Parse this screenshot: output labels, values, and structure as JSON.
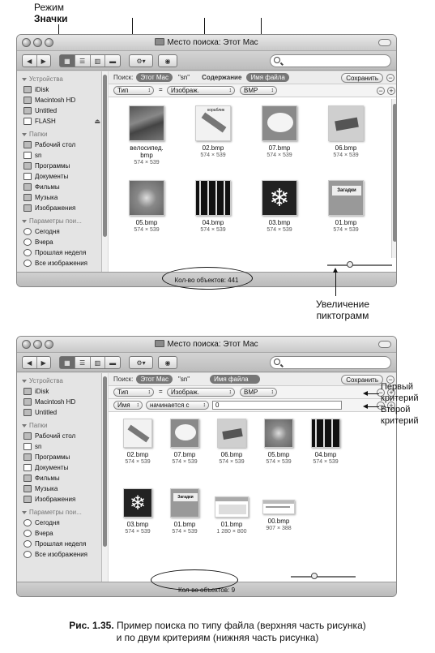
{
  "callouts": {
    "mode_line1": "Режим",
    "mode_line2": "Значки",
    "zoom_line1": "Увеличение",
    "zoom_line2": "пиктограмм",
    "crit1_line1": "Первый",
    "crit1_line2": "критерий",
    "crit2_line1": "Второй",
    "crit2_line2": "критерий"
  },
  "top_window": {
    "title": "Место поиска: Этот Mac",
    "search_label": "Поиск:",
    "scope_this_mac": "Этот Mac",
    "scope_user": "\"sn\"",
    "by_contents": "Содержание",
    "by_filename": "Имя файла",
    "save_label": "Сохранить",
    "criteria": {
      "kind": "Тип",
      "value": "Изображ.",
      "format": "BMP"
    },
    "status": "Кол-во объектов: 441",
    "files": [
      {
        "name": "велосипед.\nbmp",
        "dims": "574 × 539"
      },
      {
        "name": "02.bmp",
        "dims": "574 × 539"
      },
      {
        "name": "07.bmp",
        "dims": "574 × 539"
      },
      {
        "name": "06.bmp",
        "dims": "574 × 539"
      },
      {
        "name": "05.bmp",
        "dims": "574 × 539"
      },
      {
        "name": "04.bmp",
        "dims": "574 × 539"
      },
      {
        "name": "03.bmp",
        "dims": "574 × 539"
      },
      {
        "name": "01.bmp",
        "dims": "574 × 539"
      }
    ]
  },
  "bottom_window": {
    "title": "Место поиска: Этот Mac",
    "search_label": "Поиск:",
    "scope_this_mac": "Этот Mac",
    "scope_user": "\"sn\"",
    "by_filename": "Имя файла",
    "save_label": "Сохранить",
    "criteria1": {
      "kind": "Тип",
      "value": "Изображ.",
      "format": "BMP"
    },
    "criteria2": {
      "attr": "Имя",
      "op": "начинается с",
      "value": "0"
    },
    "status": "Кол-во объектов: 9",
    "files": [
      {
        "name": "02.bmp",
        "dims": "574 × 539"
      },
      {
        "name": "07.bmp",
        "dims": "574 × 539"
      },
      {
        "name": "06.bmp",
        "dims": "574 × 539"
      },
      {
        "name": "05.bmp",
        "dims": "574 × 539"
      },
      {
        "name": "04.bmp",
        "dims": "574 × 539"
      },
      {
        "name": "03.bmp",
        "dims": "574 × 539"
      },
      {
        "name": "01.bmp",
        "dims": "574 × 539"
      },
      {
        "name": "01.bmp",
        "dims": "1 280 × 800"
      },
      {
        "name": "00.bmp",
        "dims": "907 × 388"
      }
    ]
  },
  "sidebar": {
    "devices_head": "Устройства",
    "devices": [
      "iDisk",
      "Macintosh HD",
      "Untitled",
      "FLASH"
    ],
    "places_head": "Папки",
    "places": [
      "Рабочий стол",
      "sn",
      "Программы",
      "Документы",
      "Фильмы",
      "Музыка",
      "Изображения"
    ],
    "search_head": "Параметры пои...",
    "searches": [
      "Сегодня",
      "Вчера",
      "Прошлая неделя",
      "Все изображения"
    ]
  },
  "thumb_texts": {
    "t02": "кораблик",
    "t01": "Загадки"
  },
  "caption": {
    "label": "Рис. 1.35.",
    "line1": "Пример поиска по типу файла (верхняя часть рисунка)",
    "line2": "и по двум критериям (нижняя часть рисунка)"
  }
}
